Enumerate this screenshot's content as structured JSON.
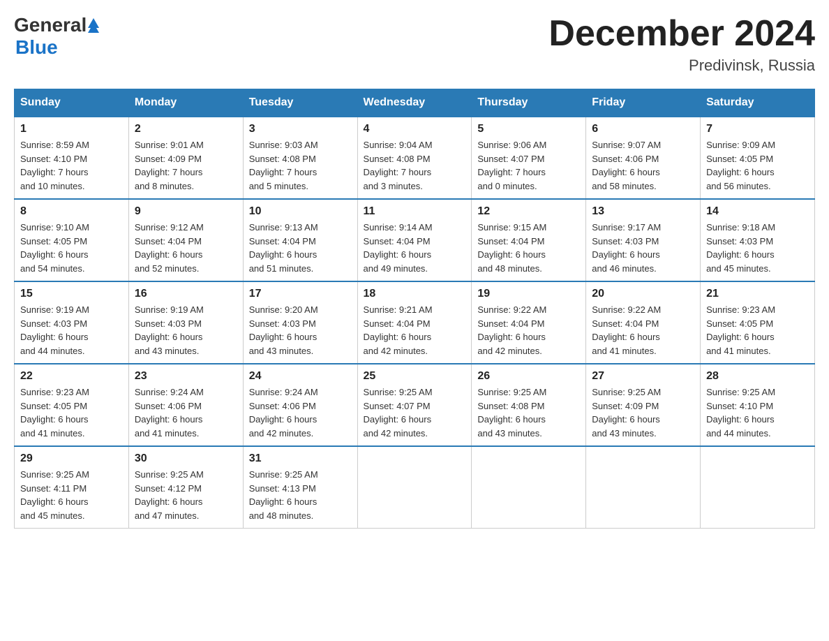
{
  "logo": {
    "general": "General",
    "blue": "Blue"
  },
  "title": "December 2024",
  "location": "Predivinsk, Russia",
  "days_of_week": [
    "Sunday",
    "Monday",
    "Tuesday",
    "Wednesday",
    "Thursday",
    "Friday",
    "Saturday"
  ],
  "weeks": [
    [
      {
        "day": "1",
        "info": "Sunrise: 8:59 AM\nSunset: 4:10 PM\nDaylight: 7 hours\nand 10 minutes."
      },
      {
        "day": "2",
        "info": "Sunrise: 9:01 AM\nSunset: 4:09 PM\nDaylight: 7 hours\nand 8 minutes."
      },
      {
        "day": "3",
        "info": "Sunrise: 9:03 AM\nSunset: 4:08 PM\nDaylight: 7 hours\nand 5 minutes."
      },
      {
        "day": "4",
        "info": "Sunrise: 9:04 AM\nSunset: 4:08 PM\nDaylight: 7 hours\nand 3 minutes."
      },
      {
        "day": "5",
        "info": "Sunrise: 9:06 AM\nSunset: 4:07 PM\nDaylight: 7 hours\nand 0 minutes."
      },
      {
        "day": "6",
        "info": "Sunrise: 9:07 AM\nSunset: 4:06 PM\nDaylight: 6 hours\nand 58 minutes."
      },
      {
        "day": "7",
        "info": "Sunrise: 9:09 AM\nSunset: 4:05 PM\nDaylight: 6 hours\nand 56 minutes."
      }
    ],
    [
      {
        "day": "8",
        "info": "Sunrise: 9:10 AM\nSunset: 4:05 PM\nDaylight: 6 hours\nand 54 minutes."
      },
      {
        "day": "9",
        "info": "Sunrise: 9:12 AM\nSunset: 4:04 PM\nDaylight: 6 hours\nand 52 minutes."
      },
      {
        "day": "10",
        "info": "Sunrise: 9:13 AM\nSunset: 4:04 PM\nDaylight: 6 hours\nand 51 minutes."
      },
      {
        "day": "11",
        "info": "Sunrise: 9:14 AM\nSunset: 4:04 PM\nDaylight: 6 hours\nand 49 minutes."
      },
      {
        "day": "12",
        "info": "Sunrise: 9:15 AM\nSunset: 4:04 PM\nDaylight: 6 hours\nand 48 minutes."
      },
      {
        "day": "13",
        "info": "Sunrise: 9:17 AM\nSunset: 4:03 PM\nDaylight: 6 hours\nand 46 minutes."
      },
      {
        "day": "14",
        "info": "Sunrise: 9:18 AM\nSunset: 4:03 PM\nDaylight: 6 hours\nand 45 minutes."
      }
    ],
    [
      {
        "day": "15",
        "info": "Sunrise: 9:19 AM\nSunset: 4:03 PM\nDaylight: 6 hours\nand 44 minutes."
      },
      {
        "day": "16",
        "info": "Sunrise: 9:19 AM\nSunset: 4:03 PM\nDaylight: 6 hours\nand 43 minutes."
      },
      {
        "day": "17",
        "info": "Sunrise: 9:20 AM\nSunset: 4:03 PM\nDaylight: 6 hours\nand 43 minutes."
      },
      {
        "day": "18",
        "info": "Sunrise: 9:21 AM\nSunset: 4:04 PM\nDaylight: 6 hours\nand 42 minutes."
      },
      {
        "day": "19",
        "info": "Sunrise: 9:22 AM\nSunset: 4:04 PM\nDaylight: 6 hours\nand 42 minutes."
      },
      {
        "day": "20",
        "info": "Sunrise: 9:22 AM\nSunset: 4:04 PM\nDaylight: 6 hours\nand 41 minutes."
      },
      {
        "day": "21",
        "info": "Sunrise: 9:23 AM\nSunset: 4:05 PM\nDaylight: 6 hours\nand 41 minutes."
      }
    ],
    [
      {
        "day": "22",
        "info": "Sunrise: 9:23 AM\nSunset: 4:05 PM\nDaylight: 6 hours\nand 41 minutes."
      },
      {
        "day": "23",
        "info": "Sunrise: 9:24 AM\nSunset: 4:06 PM\nDaylight: 6 hours\nand 41 minutes."
      },
      {
        "day": "24",
        "info": "Sunrise: 9:24 AM\nSunset: 4:06 PM\nDaylight: 6 hours\nand 42 minutes."
      },
      {
        "day": "25",
        "info": "Sunrise: 9:25 AM\nSunset: 4:07 PM\nDaylight: 6 hours\nand 42 minutes."
      },
      {
        "day": "26",
        "info": "Sunrise: 9:25 AM\nSunset: 4:08 PM\nDaylight: 6 hours\nand 43 minutes."
      },
      {
        "day": "27",
        "info": "Sunrise: 9:25 AM\nSunset: 4:09 PM\nDaylight: 6 hours\nand 43 minutes."
      },
      {
        "day": "28",
        "info": "Sunrise: 9:25 AM\nSunset: 4:10 PM\nDaylight: 6 hours\nand 44 minutes."
      }
    ],
    [
      {
        "day": "29",
        "info": "Sunrise: 9:25 AM\nSunset: 4:11 PM\nDaylight: 6 hours\nand 45 minutes."
      },
      {
        "day": "30",
        "info": "Sunrise: 9:25 AM\nSunset: 4:12 PM\nDaylight: 6 hours\nand 47 minutes."
      },
      {
        "day": "31",
        "info": "Sunrise: 9:25 AM\nSunset: 4:13 PM\nDaylight: 6 hours\nand 48 minutes."
      },
      {
        "day": "",
        "info": ""
      },
      {
        "day": "",
        "info": ""
      },
      {
        "day": "",
        "info": ""
      },
      {
        "day": "",
        "info": ""
      }
    ]
  ]
}
